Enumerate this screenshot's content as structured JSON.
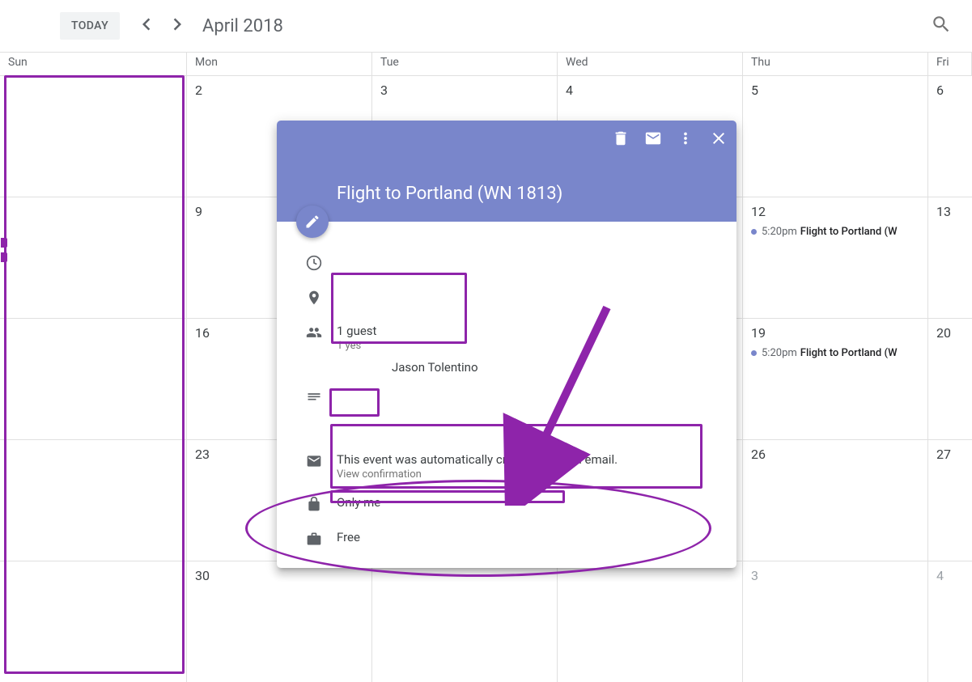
{
  "header": {
    "today_label": "TODAY",
    "month_title": "April 2018"
  },
  "day_headers": [
    "Sun",
    "Mon",
    "Tue",
    "Wed",
    "Thu",
    "Fri"
  ],
  "rows": [
    [
      "",
      "2",
      "3",
      "4",
      "5",
      "6"
    ],
    [
      "",
      "9",
      "",
      "",
      "12",
      "13"
    ],
    [
      "",
      "16",
      "",
      "",
      "19",
      "20"
    ],
    [
      "",
      "23",
      "",
      "",
      "26",
      "27"
    ],
    [
      "",
      "30",
      "",
      "",
      "3",
      "4"
    ]
  ],
  "muted_cells": [
    [
      4,
      4
    ],
    [
      4,
      5
    ]
  ],
  "events": [
    {
      "row": 1,
      "col": 4,
      "time": "5:20pm",
      "title": "Flight to Portland (W"
    },
    {
      "row": 2,
      "col": 4,
      "time": "5:20pm",
      "title": "Flight to Portland (W"
    }
  ],
  "popover": {
    "title": "Flight to Portland (WN 1813)",
    "guests_label": "1 guest",
    "guests_sub": "1 yes",
    "guest_name": "Jason Tolentino",
    "auto_text": "This event was automatically created from an email.",
    "auto_link": "View confirmation",
    "visibility": "Only me",
    "busy": "Free"
  }
}
